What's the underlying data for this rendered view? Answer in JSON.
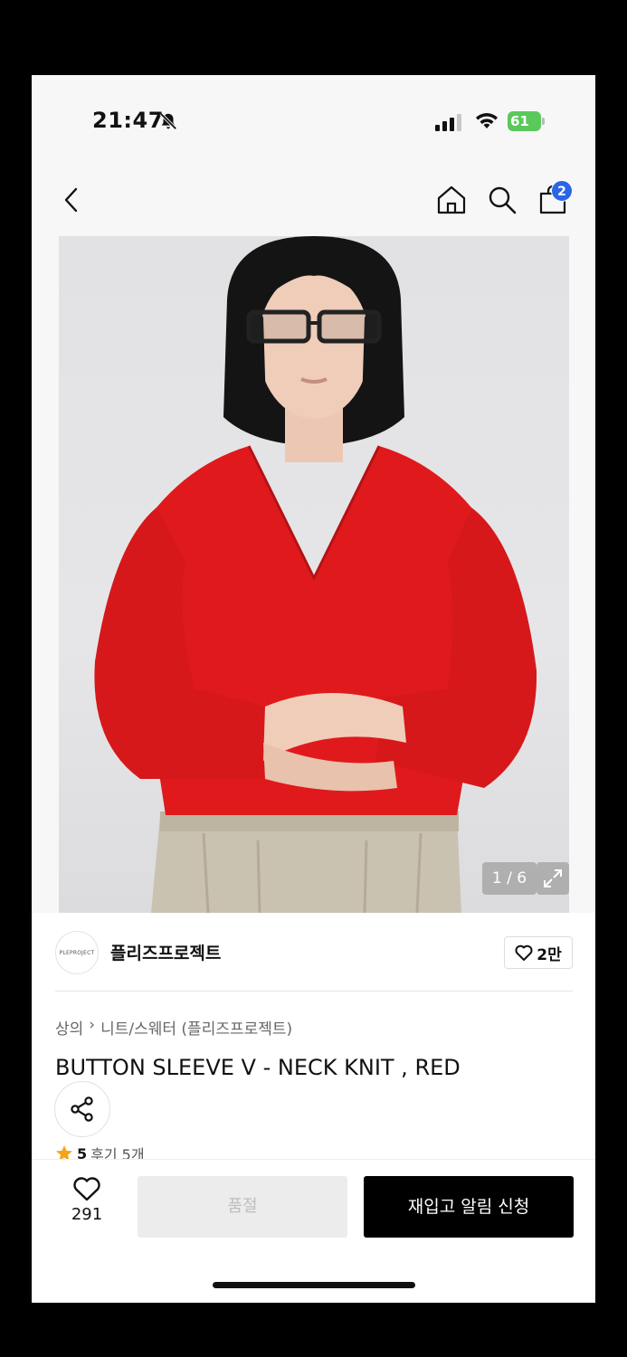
{
  "status_bar": {
    "time": "21:47",
    "battery": "61"
  },
  "nav": {
    "cart_count": "2"
  },
  "gallery": {
    "counter": "1 / 6"
  },
  "brand": {
    "logo_text": "PLEPROJECT",
    "name": "플리즈프로젝트",
    "likes": "2만"
  },
  "breadcrumb": {
    "category": "상의",
    "separator": "›",
    "subcategory": "니트/스웨터 (플리즈프로젝트)"
  },
  "product": {
    "title": "BUTTON SLEEVE V - NECK KNIT , RED"
  },
  "rating": {
    "score": "5",
    "reviews": "후기 5개"
  },
  "bottom_bar": {
    "wish_count": "291",
    "soldout_label": "품절",
    "restock_label": "재입고 알림 신청"
  },
  "colors": {
    "sweater": "#e01a1c",
    "badge": "#2a66e5",
    "battery": "#5bc85b",
    "primary_button": "#000000"
  }
}
